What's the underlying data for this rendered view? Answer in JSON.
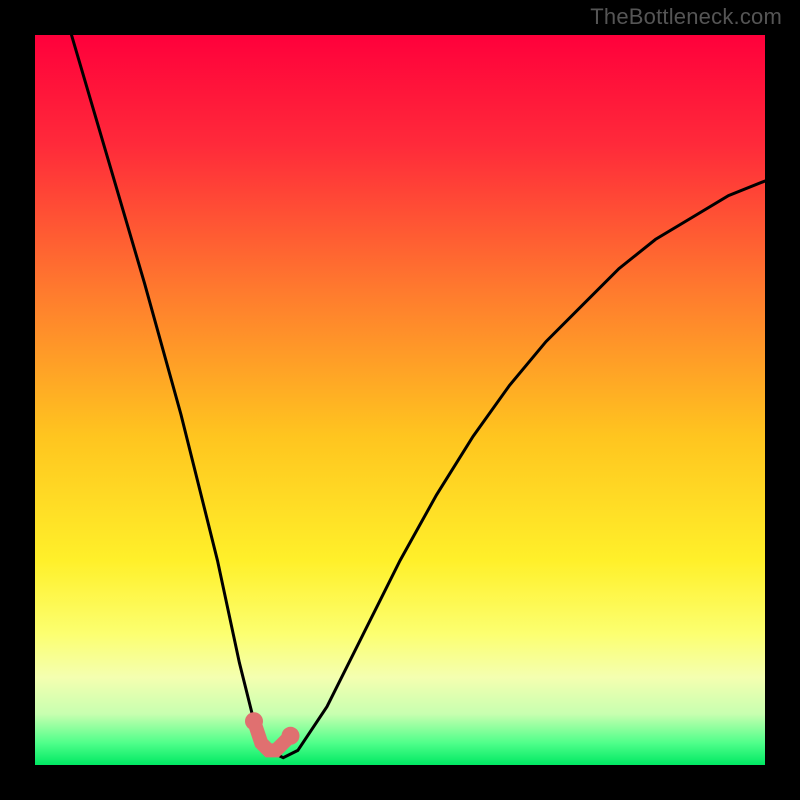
{
  "watermark": "TheBottleneck.com",
  "chart_data": {
    "type": "line",
    "title": "",
    "xlabel": "",
    "ylabel": "",
    "xlim": [
      0,
      100
    ],
    "ylim": [
      0,
      100
    ],
    "grid": false,
    "legend": false,
    "series": [
      {
        "name": "bottleneck-curve",
        "x": [
          5,
          10,
          15,
          20,
          25,
          28,
          30,
          32,
          34,
          36,
          40,
          45,
          50,
          55,
          60,
          65,
          70,
          75,
          80,
          85,
          90,
          95,
          100
        ],
        "y": [
          100,
          83,
          66,
          48,
          28,
          14,
          6,
          2,
          1,
          2,
          8,
          18,
          28,
          37,
          45,
          52,
          58,
          63,
          68,
          72,
          75,
          78,
          80
        ]
      }
    ],
    "highlight_points": {
      "name": "bottleneck-min",
      "x": [
        30,
        31,
        32,
        33,
        35
      ],
      "y": [
        6,
        3,
        2,
        2,
        4
      ]
    },
    "background_gradient": [
      {
        "stop": 0.0,
        "color": "#ff003b"
      },
      {
        "stop": 0.15,
        "color": "#ff2a3a"
      },
      {
        "stop": 0.35,
        "color": "#ff7a2e"
      },
      {
        "stop": 0.55,
        "color": "#ffc51f"
      },
      {
        "stop": 0.72,
        "color": "#fff02a"
      },
      {
        "stop": 0.82,
        "color": "#fcff70"
      },
      {
        "stop": 0.88,
        "color": "#f4ffb0"
      },
      {
        "stop": 0.93,
        "color": "#c8ffb0"
      },
      {
        "stop": 0.97,
        "color": "#4fff8a"
      },
      {
        "stop": 1.0,
        "color": "#00e863"
      }
    ]
  }
}
